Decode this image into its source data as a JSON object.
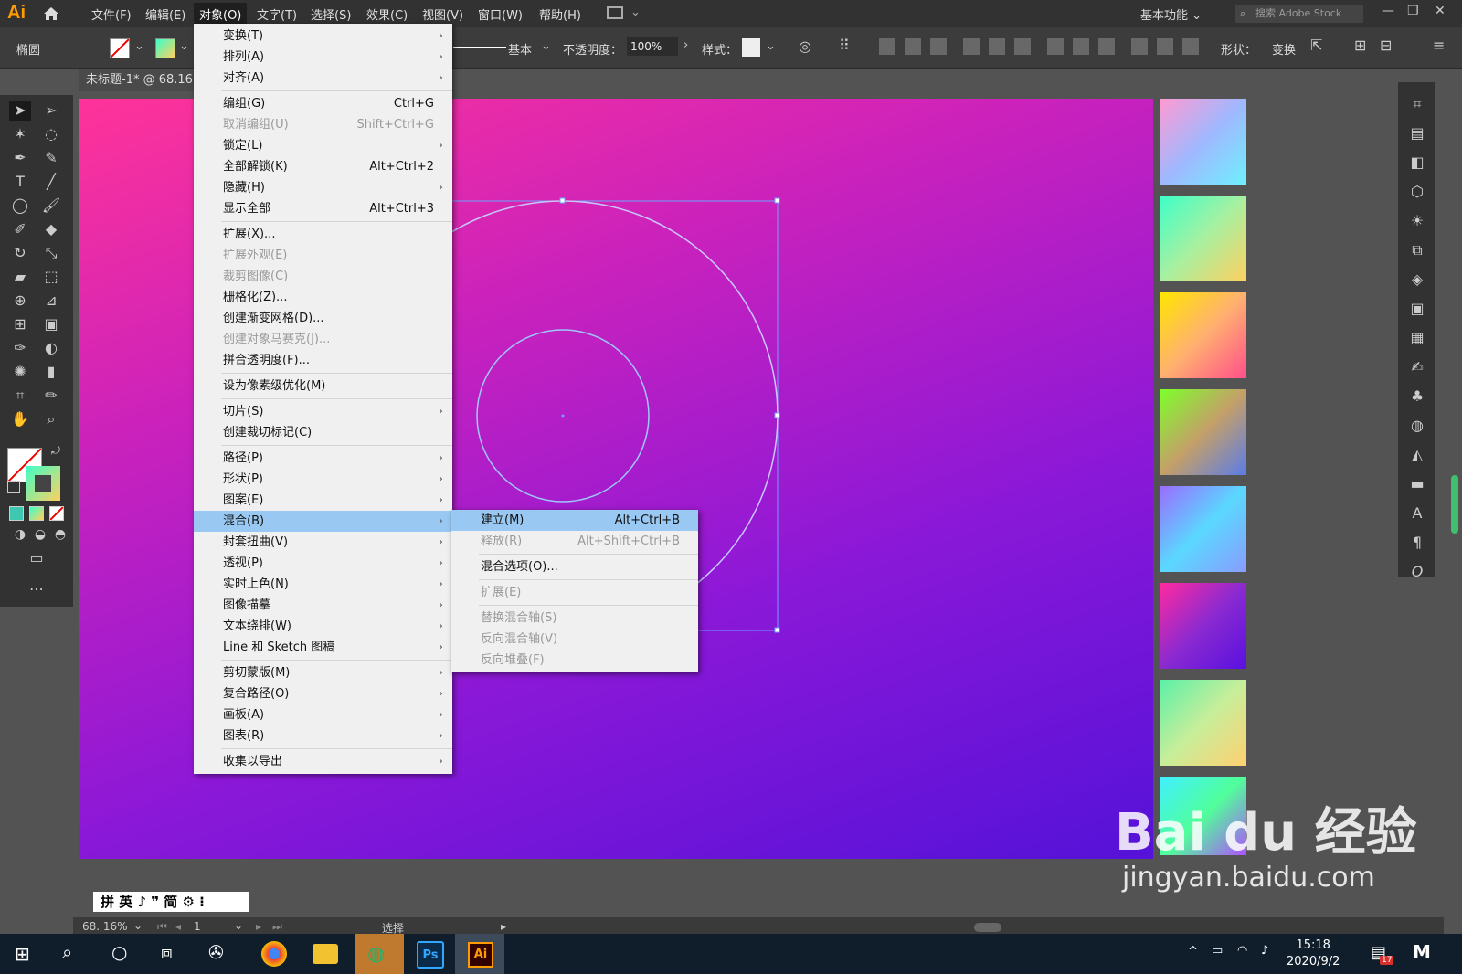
{
  "app": {
    "logo": "Ai"
  },
  "menubar": {
    "items": [
      "文件(F)",
      "编辑(E)",
      "对象(O)",
      "文字(T)",
      "选择(S)",
      "效果(C)",
      "视图(V)",
      "窗口(W)",
      "帮助(H)"
    ],
    "workspace": "基本功能",
    "stock_placeholder": "搜索 Adobe Stock"
  },
  "control": {
    "tool_name": "椭圆",
    "stroke_style": "基本",
    "opacity_label": "不透明度：",
    "opacity_value": "100%",
    "style_label": "样式：",
    "shape_label": "形状：",
    "transform_label": "变换"
  },
  "document": {
    "tab_title": "未标题-1* @ 68.16"
  },
  "object_menu": {
    "items": [
      {
        "label": "变换(T)",
        "submenu": true
      },
      {
        "label": "排列(A)",
        "submenu": true
      },
      {
        "label": "对齐(A)",
        "submenu": true
      },
      {
        "sep": true
      },
      {
        "label": "编组(G)",
        "shortcut": "Ctrl+G"
      },
      {
        "label": "取消编组(U)",
        "shortcut": "Shift+Ctrl+G",
        "disabled": true
      },
      {
        "label": "锁定(L)",
        "submenu": true
      },
      {
        "label": "全部解锁(K)",
        "shortcut": "Alt+Ctrl+2"
      },
      {
        "label": "隐藏(H)",
        "submenu": true
      },
      {
        "label": "显示全部",
        "shortcut": "Alt+Ctrl+3"
      },
      {
        "sep": true
      },
      {
        "label": "扩展(X)..."
      },
      {
        "label": "扩展外观(E)",
        "disabled": true
      },
      {
        "label": "裁剪图像(C)",
        "disabled": true
      },
      {
        "label": "栅格化(Z)..."
      },
      {
        "label": "创建渐变网格(D)..."
      },
      {
        "label": "创建对象马赛克(J)...",
        "disabled": true
      },
      {
        "label": "拼合透明度(F)..."
      },
      {
        "sep": true
      },
      {
        "label": "设为像素级优化(M)"
      },
      {
        "sep": true
      },
      {
        "label": "切片(S)",
        "submenu": true
      },
      {
        "label": "创建裁切标记(C)"
      },
      {
        "sep": true
      },
      {
        "label": "路径(P)",
        "submenu": true
      },
      {
        "label": "形状(P)",
        "submenu": true
      },
      {
        "label": "图案(E)",
        "submenu": true
      },
      {
        "label": "混合(B)",
        "submenu": true,
        "highlight": true
      },
      {
        "label": "封套扭曲(V)",
        "submenu": true
      },
      {
        "label": "透视(P)",
        "submenu": true
      },
      {
        "label": "实时上色(N)",
        "submenu": true
      },
      {
        "label": "图像描摹",
        "submenu": true
      },
      {
        "label": "文本绕排(W)",
        "submenu": true
      },
      {
        "label": "Line 和 Sketch 图稿",
        "submenu": true
      },
      {
        "sep": true
      },
      {
        "label": "剪切蒙版(M)",
        "submenu": true
      },
      {
        "label": "复合路径(O)",
        "submenu": true
      },
      {
        "label": "画板(A)",
        "submenu": true
      },
      {
        "label": "图表(R)",
        "submenu": true
      },
      {
        "sep": true
      },
      {
        "label": "收集以导出",
        "submenu": true
      }
    ]
  },
  "blend_menu": {
    "items": [
      {
        "label": "建立(M)",
        "shortcut": "Alt+Ctrl+B",
        "highlight": true
      },
      {
        "label": "释放(R)",
        "shortcut": "Alt+Shift+Ctrl+B",
        "disabled": true
      },
      {
        "sep": true
      },
      {
        "label": "混合选项(O)..."
      },
      {
        "sep": true
      },
      {
        "label": "扩展(E)",
        "disabled": true
      },
      {
        "sep": true
      },
      {
        "label": "替换混合轴(S)",
        "disabled": true
      },
      {
        "label": "反向混合轴(V)",
        "disabled": true
      },
      {
        "label": "反向堆叠(F)",
        "disabled": true
      }
    ]
  },
  "gradient_swatches": [
    [
      "#ff9ad2",
      "#9fb8ff",
      "#6ff0ff"
    ],
    [
      "#3dffc8",
      "#a8f0a0",
      "#ffd060"
    ],
    [
      "#ffe600",
      "#ffb070",
      "#ff4f8a"
    ],
    [
      "#7dff2a",
      "#c4a068",
      "#5a7ce8"
    ],
    [
      "#9a6cff",
      "#5ad8ff",
      "#8a9cff"
    ],
    [
      "#ff2aa0",
      "#8a2ad0",
      "#5a10e0"
    ],
    [
      "#5cf0a8",
      "#c8ee9a",
      "#ffd070"
    ],
    [
      "#40f0ff",
      "#50ff9a",
      "#b050ff"
    ]
  ],
  "status": {
    "zoom": "68. 16%",
    "page": "1",
    "mode": "选择"
  },
  "ime": {
    "text": "拼 英 ♪ ❞ 简 ⚙ ⁝"
  },
  "taskbar": {
    "time": "15:18",
    "date": "2020/9/2",
    "notification_count": "17"
  },
  "watermark": {
    "brand": "Bai du 经验",
    "url": "jingyan.baidu.com"
  }
}
